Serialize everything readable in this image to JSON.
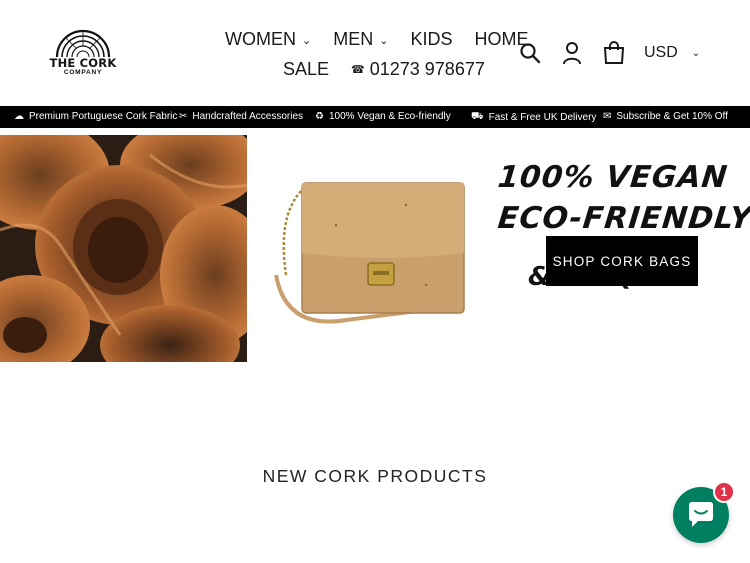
{
  "header": {
    "logo_text": "THE CORK",
    "logo_sub": "COMPANY",
    "nav_row1": [
      {
        "label": "WOMEN",
        "dropdown": true
      },
      {
        "label": "MEN",
        "dropdown": true
      },
      {
        "label": "KIDS",
        "dropdown": false
      },
      {
        "label": "HOME",
        "dropdown": false
      }
    ],
    "nav_row2": [
      {
        "label": "SALE"
      },
      {
        "label": "01273 978677",
        "icon": "phone-icon"
      }
    ],
    "icons": [
      "search-icon",
      "account-icon",
      "cart-icon"
    ],
    "currency": "USD"
  },
  "usp_bar": [
    {
      "icon": "cloud-icon",
      "text": "Premium Portuguese Cork Fabric"
    },
    {
      "icon": "scissors-icon",
      "text": "Handcrafted Accessories"
    },
    {
      "icon": "recycle-icon",
      "text": "100% Vegan & Eco-friendly"
    },
    {
      "icon": "truck-icon",
      "text": "Fast & Free UK Delivery"
    },
    {
      "icon": "mail-icon",
      "text": "Subscribe & Get 10% Off"
    }
  ],
  "hero": {
    "line1": "100% VEGAN",
    "line2": "ECO-FRIENDLY",
    "line3": "& UNIQUE",
    "button": "SHOP CORK BAGS"
  },
  "section": {
    "title": "NEW CORK PRODUCTS"
  },
  "chat": {
    "badge": "1",
    "icon": "chat-icon",
    "color": "#008060",
    "badge_color": "#e0314b"
  }
}
